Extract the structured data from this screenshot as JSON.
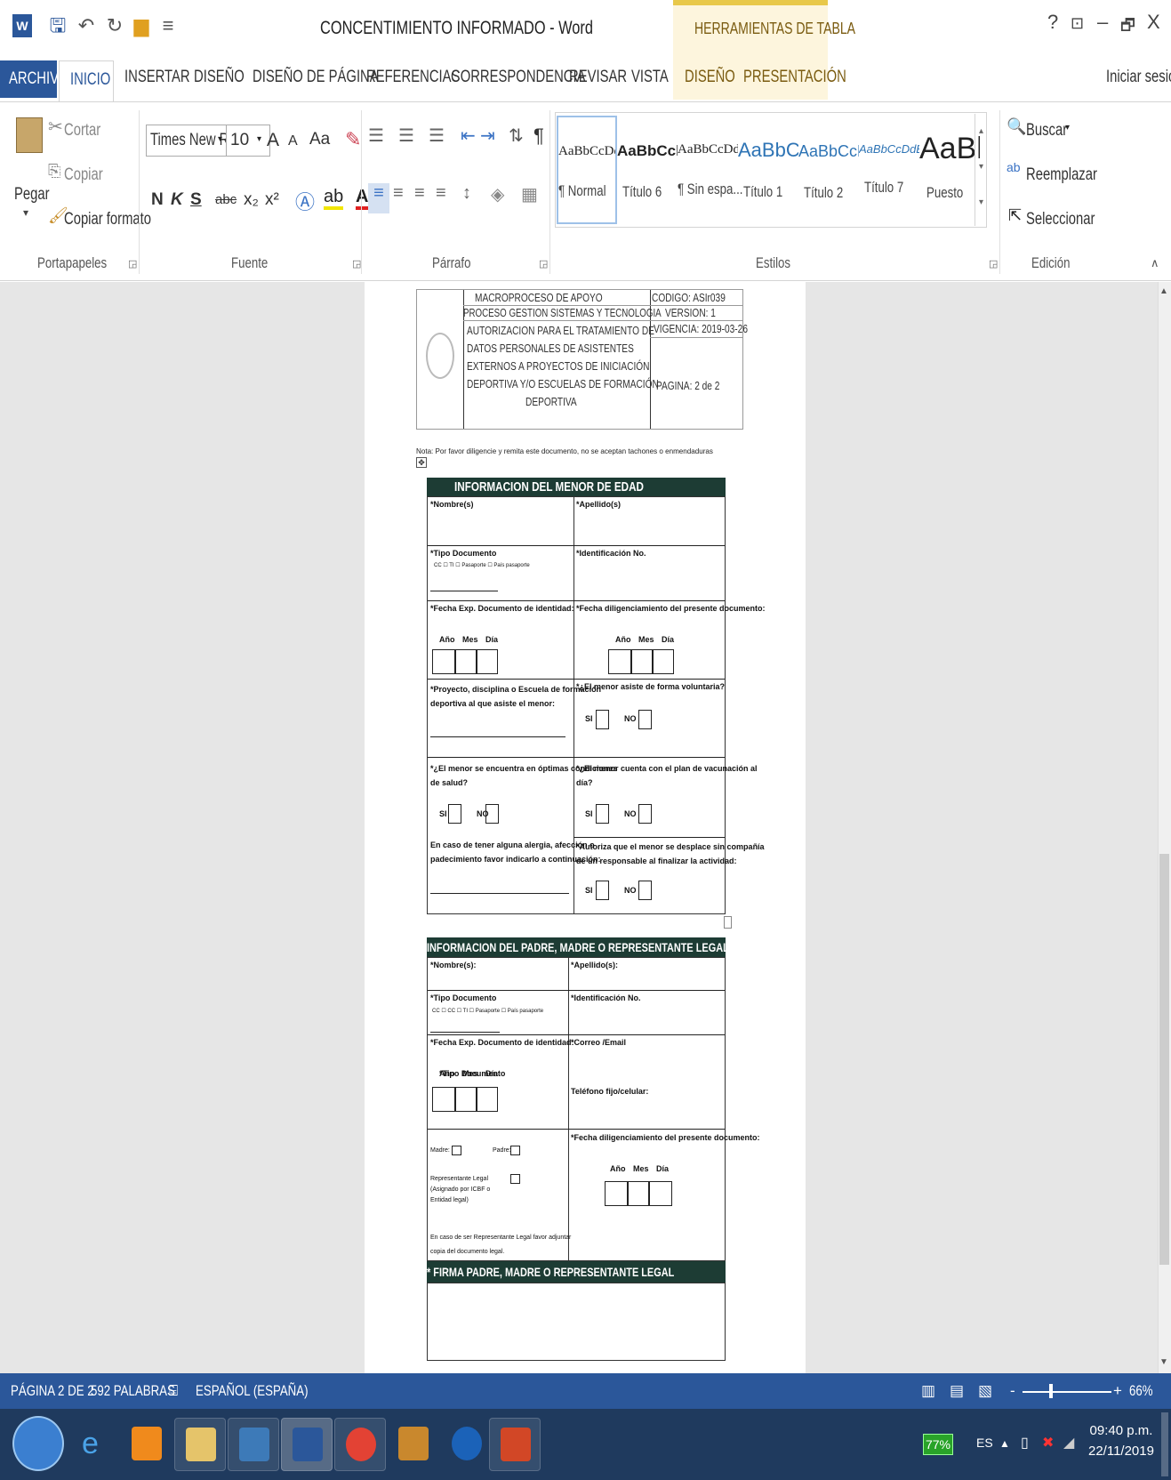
{
  "window": {
    "title": "CONCENTIMIENTO INFORMADO - Word",
    "context_tab_group": "HERRAMIENTAS DE TABLA",
    "help": "?",
    "restore_label": "⊡",
    "minimize": "–",
    "maximize": "🗗",
    "close": "X",
    "signin": "Iniciar sesión"
  },
  "tabs": [
    "ARCHIVO",
    "INICIO",
    "INSERTAR",
    "DISEÑO",
    "DISEÑO DE PÁGINA",
    "REFERENCIAS",
    "CORRESPONDENCIA",
    "REVISAR",
    "VISTA",
    "DISEÑO",
    "PRESENTACIÓN"
  ],
  "clipboard": {
    "paste": "Pegar",
    "cut": "Cortar",
    "copy": "Copiar",
    "format_painter": "Copiar formato",
    "group": "Portapapeles"
  },
  "font": {
    "name": "Times New Ro",
    "size": "10",
    "bold": "N",
    "italic": "K",
    "underline": "S",
    "strike": "abc",
    "sub": "x₂",
    "sup": "x²",
    "grow": "A",
    "shrink": "A",
    "case": "Aa",
    "group": "Fuente"
  },
  "paragraph": {
    "group": "Párrafo",
    "pilcrow": "¶"
  },
  "styles": {
    "group": "Estilos",
    "items": [
      {
        "sample": "AaBbCcDd",
        "name": "¶ Normal"
      },
      {
        "sample": "AaBbCcl",
        "name": "Título 6"
      },
      {
        "sample": "AaBbCcDd",
        "name": "¶ Sin espa..."
      },
      {
        "sample": "AaBbCc",
        "name": "Título 1"
      },
      {
        "sample": "AaBbCcD",
        "name": "Título 2"
      },
      {
        "sample": "AaBbCcDdE",
        "name": "Título 7"
      },
      {
        "sample": "AaBl",
        "name": "Puesto"
      }
    ]
  },
  "editing": {
    "find": "Buscar",
    "replace": "Reemplazar",
    "select": "Seleccionar",
    "group": "Edición"
  },
  "doc_header": {
    "macro": "MACROPROCESO DE APOYO",
    "code": "CODIGO: ASIr039",
    "process": "PROCESO GESTION SISTEMAS Y TECNOLOGIA",
    "version": "VERSION: 1",
    "title_lines": [
      "AUTORIZACION PARA EL TRATAMIENTO DE",
      "DATOS PERSONALES DE ASISTENTES",
      "EXTERNOS A PROYECTOS DE INICIACIÓN",
      "DEPORTIVA Y/O ESCUELAS DE FORMACIÓN",
      "DEPORTIVA"
    ],
    "validity": "VIGENCIA: 2019-03-26",
    "page": "PAGINA: 2 de 2"
  },
  "note": "Nota: Por favor diligencie y remita este documento, no se aceptan tachones o enmendaduras",
  "minor": {
    "title": "INFORMACION DEL MENOR DE EDAD",
    "nombre": "*Nombre(s)",
    "apellido": "*Apellido(s)",
    "tipo_doc": "*Tipo Documento",
    "tipo_opts": "CC ☐ TI ☐ Pasaporte ☐ País pasaporte",
    "ident": "*Identificación No.",
    "fecha_exp": "*Fecha Exp. Documento de identidad:",
    "fecha_dil": "*Fecha diligenciamiento del presente documento:",
    "anio": "Año",
    "mes": "Mes",
    "dia": "Día",
    "proyecto": [
      "*Proyecto, disciplina o Escuela de formación",
      "deportiva al que asiste el menor:"
    ],
    "voluntaria": "*¿El menor asiste de forma voluntaria?",
    "si": "SI",
    "no": "NO",
    "salud": [
      "*¿El menor se encuentra en óptimas condiciones",
      "de salud?"
    ],
    "vacunacion": [
      "*¿El menor cuenta con el plan de vacunación al",
      "día?"
    ],
    "alergia": [
      "En caso de tener alguna alergia, afección o",
      "padecimiento favor indicarlo a continuación:"
    ],
    "autoriza": [
      "*Autoriza que el menor se desplace sin compañía",
      "de un responsable al finalizar la actividad:"
    ]
  },
  "parent": {
    "title": "INFORMACION DEL PADRE, MADRE O REPRESENTANTE LEGAL",
    "nombre": "*Nombre(s):",
    "apellido": "*Apellido(s):",
    "tipo_doc": "*Tipo Documento",
    "tipo_opts": "CC ☐ CC ☐ TI ☐ Pasaporte ☐ País pasaporte",
    "ident": "*Identificación No.",
    "fecha_exp": "*Fecha Exp. Documento de identidad:",
    "correo": "*Correo /Email",
    "telefono": "Teléfono fijo/celular:",
    "fecha_dil": "*Fecha diligenciamiento del presente documento:",
    "madre": "Madre:",
    "padre": "Padre:",
    "rep": [
      "Representante Legal",
      "(Asignado por ICBF o",
      "Entidad legal)"
    ],
    "rep_note": [
      "En caso de ser Representante Legal favor adjuntar",
      "copia del documento legal."
    ],
    "firma": "* FIRMA PADRE, MADRE O REPRESENTANTE LEGAL"
  },
  "status": {
    "page": "PÁGINA 2 DE 2",
    "words": "592 PALABRAS",
    "lang": "ESPAÑOL (ESPAÑA)",
    "zoom": "66%"
  },
  "taskbar": {
    "battery": "77%",
    "lang": "ES",
    "time": "09:40 p.m.",
    "date": "22/11/2019"
  },
  "colors": {
    "word_blue": "#2b579a",
    "section_green": "#1d3c34",
    "context_yellow": "#e8c84a"
  }
}
